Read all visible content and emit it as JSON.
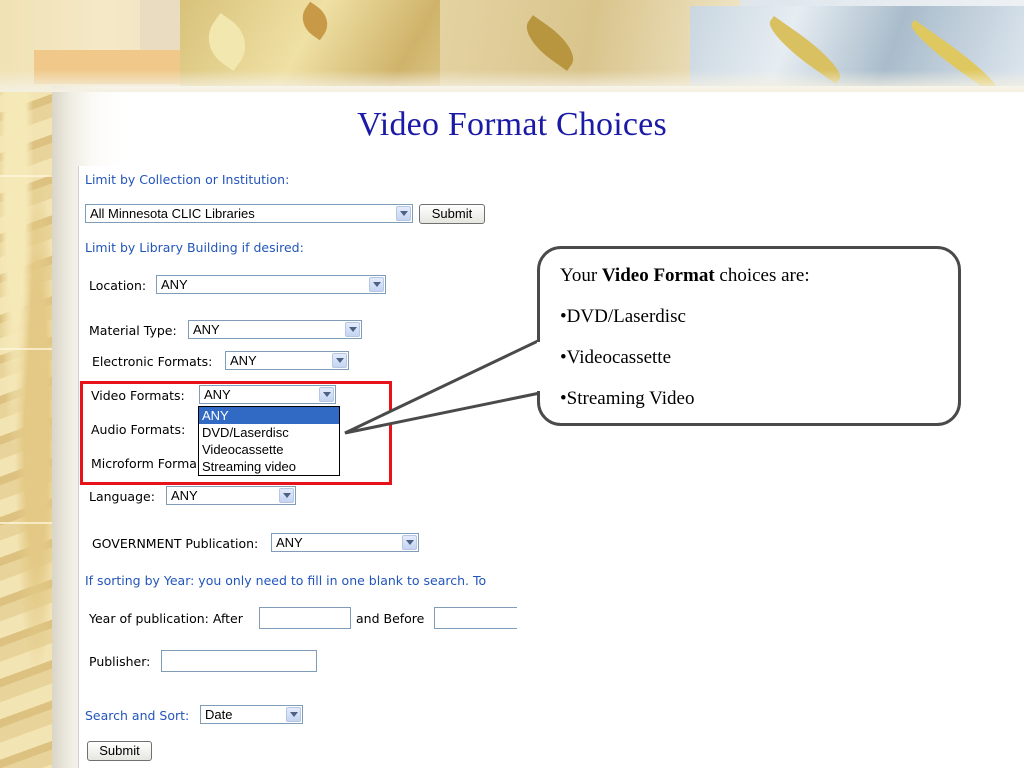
{
  "slide": {
    "title": "Video Format Choices"
  },
  "form": {
    "collection_label": "Limit by Collection or Institution:",
    "collection_value": "All Minnesota CLIC Libraries",
    "submit_top": "Submit",
    "building_label": "Limit by Library Building if desired:",
    "location_label": "Location:",
    "location_value": "ANY",
    "material_label": "Material Type:",
    "material_value": "ANY",
    "electronic_label": "Electronic Formats:",
    "electronic_value": "ANY",
    "video_label": "Video Formats:",
    "video_value": "ANY",
    "video_options": [
      "ANY",
      "DVD/Laserdisc",
      "Videocassette",
      "Streaming video"
    ],
    "audio_label": "Audio Formats:",
    "microform_label": "Microform Forma",
    "language_label": "Language:",
    "language_value": "ANY",
    "government_label": "GOVERNMENT Publication:",
    "government_value": "ANY",
    "year_note": "If sorting by Year: you only need to fill in one blank to search. To",
    "year_label": "Year of publication: After",
    "year_before_label": "and Before",
    "publisher_label": "Publisher:",
    "sort_label": "Search and Sort:",
    "sort_value": "Date",
    "submit_bottom": "Submit"
  },
  "callout": {
    "intro_prefix": "Your ",
    "intro_bold": "Video Format",
    "intro_suffix": " choices are:",
    "items": [
      "•DVD/Laserdisc",
      "•Videocassette",
      "•Streaming Video"
    ]
  },
  "colors": {
    "title": "#1a1aa6",
    "link_text": "#2255bb",
    "highlight_border": "#e8121a",
    "selected_option": "#316ac5"
  }
}
